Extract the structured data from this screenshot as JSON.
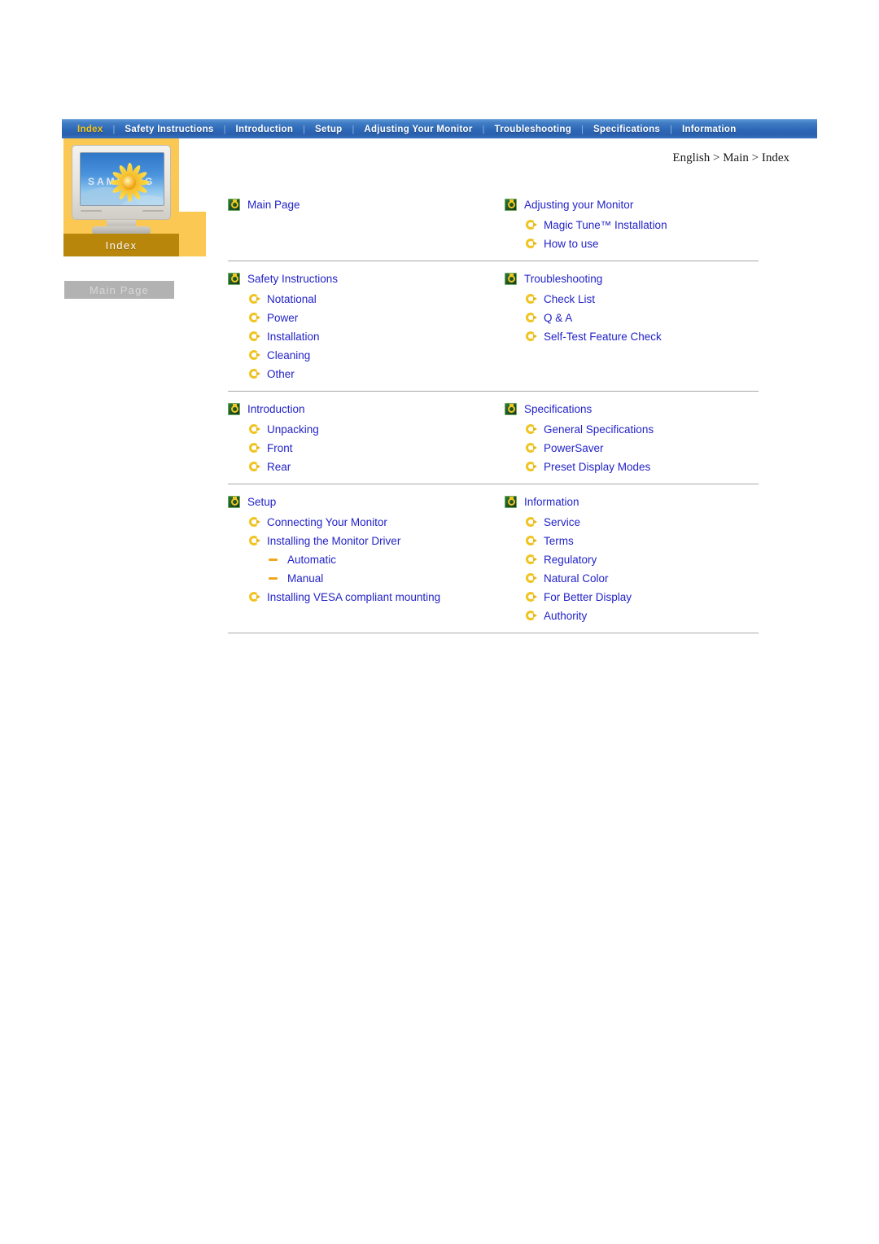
{
  "navbar": {
    "separator": "|",
    "items": [
      {
        "label": "Index",
        "active": true
      },
      {
        "label": "Safety Instructions",
        "active": false
      },
      {
        "label": "Introduction",
        "active": false
      },
      {
        "label": "Setup",
        "active": false
      },
      {
        "label": "Adjusting Your Monitor",
        "active": false
      },
      {
        "label": "Troubleshooting",
        "active": false
      },
      {
        "label": "Specifications",
        "active": false
      },
      {
        "label": "Information",
        "active": false
      }
    ]
  },
  "sidebar": {
    "image_icon": "crt-monitor-illustration",
    "screen_brand_text": "SAMSUNG",
    "caption": "Index",
    "main_page_button": "Main Page"
  },
  "breadcrumb": "English > Main > Index",
  "icons": {
    "section": "green-square-gold-ring-icon",
    "sub": "gold-circular-arrow-icon",
    "leaf": "orange-dash-icon"
  },
  "colors": {
    "link": "#2323c8",
    "nav_active": "#f5c518",
    "nav_bg": "#2f6ab8",
    "panel": "#fac853",
    "caption_bar": "#b8860b",
    "button": "#b2b2b2",
    "divider": "#a9a9a9"
  },
  "groups": [
    {
      "left": {
        "title": "Main Page",
        "items": []
      },
      "right": {
        "title": "Adjusting your Monitor",
        "items": [
          {
            "label": "Magic Tune™ Installation"
          },
          {
            "label": "How to use"
          }
        ]
      }
    },
    {
      "left": {
        "title": "Safety Instructions",
        "items": [
          {
            "label": "Notational"
          },
          {
            "label": "Power"
          },
          {
            "label": "Installation"
          },
          {
            "label": "Cleaning"
          },
          {
            "label": "Other"
          }
        ]
      },
      "right": {
        "title": "Troubleshooting",
        "items": [
          {
            "label": "Check List"
          },
          {
            "label": "Q & A"
          },
          {
            "label": "Self-Test Feature Check"
          }
        ]
      }
    },
    {
      "left": {
        "title": "Introduction",
        "items": [
          {
            "label": "Unpacking"
          },
          {
            "label": "Front"
          },
          {
            "label": "Rear"
          }
        ]
      },
      "right": {
        "title": "Specifications",
        "items": [
          {
            "label": "General Specifications"
          },
          {
            "label": "PowerSaver"
          },
          {
            "label": "Preset Display Modes"
          }
        ]
      }
    },
    {
      "left": {
        "title": "Setup",
        "items": [
          {
            "label": "Connecting Your Monitor"
          },
          {
            "label": "Installing the Monitor Driver",
            "children": [
              {
                "label": "Automatic"
              },
              {
                "label": "Manual"
              }
            ]
          },
          {
            "label": "Installing VESA compliant mounting"
          }
        ]
      },
      "right": {
        "title": "Information",
        "items": [
          {
            "label": "Service"
          },
          {
            "label": "Terms"
          },
          {
            "label": "Regulatory"
          },
          {
            "label": "Natural Color"
          },
          {
            "label": "For Better Display"
          },
          {
            "label": "Authority"
          }
        ]
      }
    }
  ]
}
